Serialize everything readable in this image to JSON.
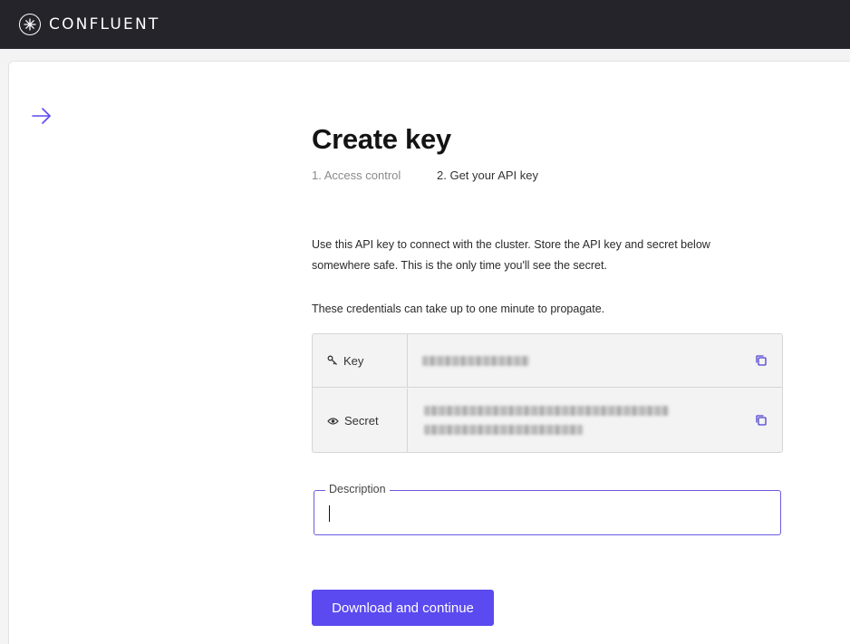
{
  "topbar": {
    "brand": "CONFLUENT"
  },
  "page": {
    "title": "Create key",
    "steps": [
      {
        "label": "1. Access control",
        "state": "done"
      },
      {
        "label": "2. Get your API key",
        "state": "active"
      }
    ],
    "intro": "Use this API key to connect with the cluster. Store the API key and secret below somewhere safe. This is the only time you'll see the secret.",
    "propagate_note": "These credentials can take up to one minute to propagate."
  },
  "credentials": {
    "key_label": "Key",
    "secret_label": "Secret",
    "key_icon": "key-icon",
    "secret_icon": "eye-icon",
    "copy_icon": "copy-icon"
  },
  "description": {
    "label": "Description",
    "value": ""
  },
  "actions": {
    "primary_label": "Download and continue"
  },
  "colors": {
    "accent": "#5b4af0",
    "topbar": "#24242a",
    "focus_border": "#6b5ae0"
  }
}
